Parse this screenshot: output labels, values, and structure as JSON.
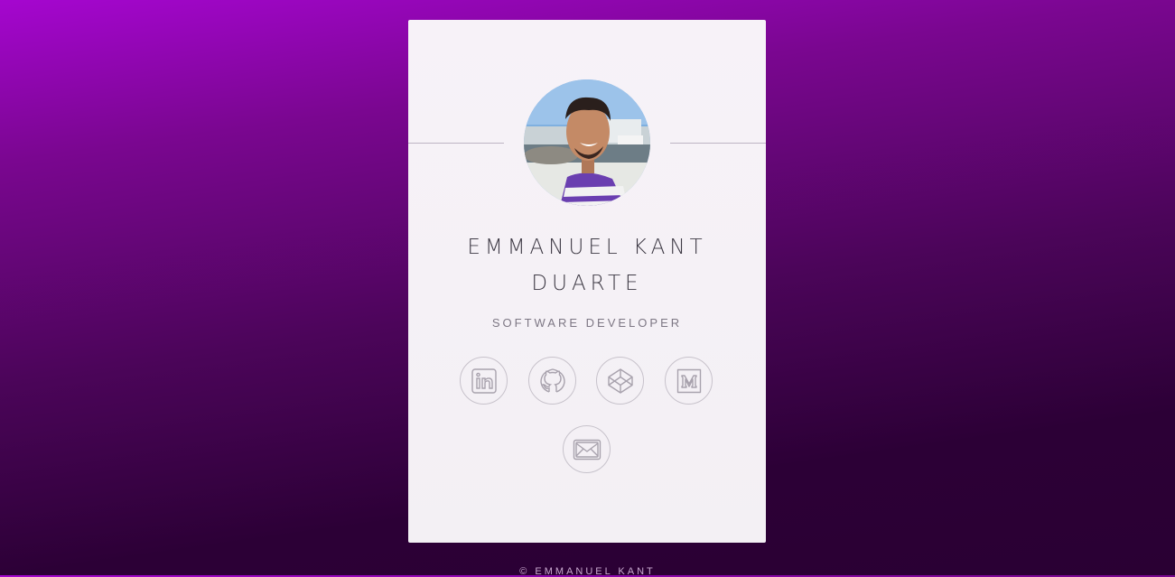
{
  "profile": {
    "name_line1": "EMMANUEL KANT",
    "name_line2": "DUARTE",
    "role": "SOFTWARE DEVELOPER",
    "avatar_icon": "profile-photo"
  },
  "social_links": [
    {
      "name": "linkedin",
      "icon": "linkedin-icon"
    },
    {
      "name": "github",
      "icon": "github-icon"
    },
    {
      "name": "codepen",
      "icon": "codepen-icon"
    },
    {
      "name": "medium",
      "icon": "medium-icon"
    },
    {
      "name": "email",
      "icon": "envelope-icon"
    }
  ],
  "footer": {
    "text": "© EMMANUEL KANT"
  },
  "colors": {
    "gradient_top": "#a506cf",
    "gradient_bottom": "#2a0033",
    "card_bg": "#f5f1f6",
    "icon_stroke": "#a8a2ad"
  }
}
